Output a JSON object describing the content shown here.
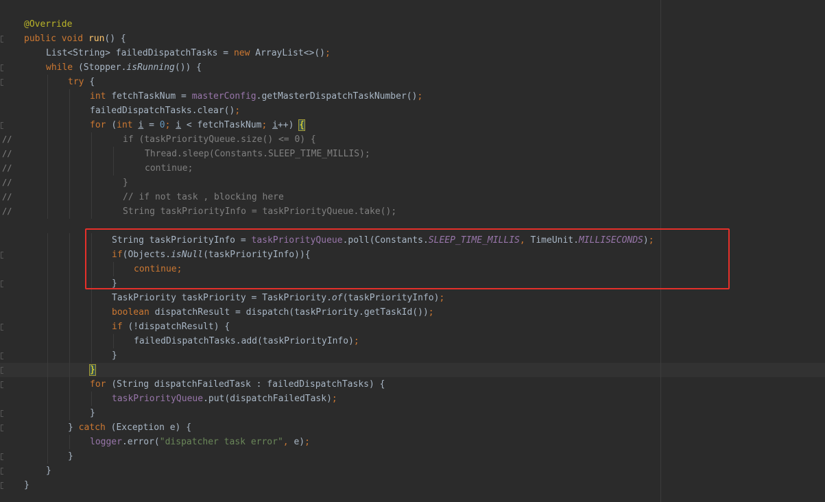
{
  "editor": {
    "language": "java",
    "colors": {
      "background": "#2b2b2b",
      "current_line": "#323232",
      "default_text": "#a9b7c6",
      "keyword": "#cc7832",
      "annotation": "#bbb529",
      "method_declaration": "#ffc66d",
      "field": "#9876aa",
      "number": "#6897bb",
      "string": "#6a8759",
      "comment": "#808080",
      "highlight_box": "#e6302a"
    },
    "annotation_box": {
      "color": "#e6302a",
      "covers_lines": "String taskPriorityInfo = taskPriorityQueue.poll(...) through closing brace"
    },
    "lines": [
      {
        "indent": 0,
        "gutter": "",
        "fold": false,
        "tokens": [
          {
            "t": "@Override",
            "c": "ann"
          }
        ]
      },
      {
        "indent": 0,
        "gutter": "",
        "fold": true,
        "tokens": [
          {
            "t": "public ",
            "c": "kw"
          },
          {
            "t": "void ",
            "c": "kw"
          },
          {
            "t": "run",
            "c": "fn"
          },
          {
            "t": "() {",
            "c": ""
          }
        ]
      },
      {
        "indent": 1,
        "gutter": "",
        "fold": false,
        "tokens": [
          {
            "t": "List<String> failedDispatchTasks = ",
            "c": ""
          },
          {
            "t": "new ",
            "c": "kw"
          },
          {
            "t": "ArrayList<>()",
            "c": ""
          },
          {
            "t": ";",
            "c": "kw"
          }
        ]
      },
      {
        "indent": 1,
        "gutter": "",
        "fold": true,
        "tokens": [
          {
            "t": "while ",
            "c": "kw"
          },
          {
            "t": "(Stopper.",
            "c": ""
          },
          {
            "t": "isRunning",
            "c": "sta"
          },
          {
            "t": "()) {",
            "c": ""
          }
        ]
      },
      {
        "indent": 2,
        "gutter": "",
        "fold": true,
        "tokens": [
          {
            "t": "try ",
            "c": "kw"
          },
          {
            "t": "{",
            "c": ""
          }
        ]
      },
      {
        "indent": 3,
        "gutter": "",
        "fold": false,
        "tokens": [
          {
            "t": "int ",
            "c": "kw"
          },
          {
            "t": "fetchTaskNum = ",
            "c": ""
          },
          {
            "t": "masterConfig",
            "c": "fld"
          },
          {
            "t": ".getMasterDispatchTaskNumber()",
            "c": ""
          },
          {
            "t": ";",
            "c": "kw"
          }
        ]
      },
      {
        "indent": 3,
        "gutter": "",
        "fold": false,
        "tokens": [
          {
            "t": "failedDispatchTasks.clear()",
            "c": ""
          },
          {
            "t": ";",
            "c": "kw"
          }
        ]
      },
      {
        "indent": 3,
        "gutter": "",
        "fold": true,
        "tokens": [
          {
            "t": "for ",
            "c": "kw"
          },
          {
            "t": "(",
            "c": ""
          },
          {
            "t": "int ",
            "c": "kw"
          },
          {
            "t": "i",
            "c": "u"
          },
          {
            "t": " = ",
            "c": ""
          },
          {
            "t": "0",
            "c": "num"
          },
          {
            "t": "; ",
            "c": "kw"
          },
          {
            "t": "i",
            "c": "u"
          },
          {
            "t": " < fetchTaskNum",
            "c": ""
          },
          {
            "t": "; ",
            "c": "kw"
          },
          {
            "t": "i",
            "c": "u"
          },
          {
            "t": "++) ",
            "c": ""
          },
          {
            "t": "{",
            "c": "brace"
          }
        ]
      },
      {
        "indent": 0,
        "gutter": "//",
        "fold": false,
        "cmt_indent": 4.5,
        "tokens": [
          {
            "t": "if (taskPriorityQueue.size() <= 0) {",
            "c": "cmt"
          }
        ]
      },
      {
        "indent": 0,
        "gutter": "//",
        "fold": false,
        "cmt_indent": 5.5,
        "tokens": [
          {
            "t": "Thread.sleep(Constants.SLEEP_TIME_MILLIS);",
            "c": "cmt"
          }
        ]
      },
      {
        "indent": 0,
        "gutter": "//",
        "fold": false,
        "cmt_indent": 5.5,
        "tokens": [
          {
            "t": "continue;",
            "c": "cmt"
          }
        ]
      },
      {
        "indent": 0,
        "gutter": "//",
        "fold": false,
        "cmt_indent": 4.5,
        "tokens": [
          {
            "t": "}",
            "c": "cmt"
          }
        ]
      },
      {
        "indent": 0,
        "gutter": "//",
        "fold": false,
        "cmt_indent": 4.5,
        "tokens": [
          {
            "t": "// if not task , blocking here",
            "c": "cmt"
          }
        ]
      },
      {
        "indent": 0,
        "gutter": "//",
        "fold": false,
        "cmt_indent": 4.5,
        "tokens": [
          {
            "t": "String taskPriorityInfo = taskPriorityQueue.take();",
            "c": "cmt"
          }
        ]
      },
      {
        "indent": 0,
        "gutter": "",
        "fold": false,
        "tokens": []
      },
      {
        "indent": 4,
        "gutter": "",
        "fold": false,
        "tokens": [
          {
            "t": "String taskPriorityInfo = ",
            "c": ""
          },
          {
            "t": "taskPriorityQueue",
            "c": "fld"
          },
          {
            "t": ".poll(Constants.",
            "c": ""
          },
          {
            "t": "SLEEP_TIME_MILLIS",
            "c": "fldi"
          },
          {
            "t": ", ",
            "c": "kw"
          },
          {
            "t": "TimeUnit.",
            "c": ""
          },
          {
            "t": "MILLISECONDS",
            "c": "fldi"
          },
          {
            "t": ")",
            "c": ""
          },
          {
            "t": ";",
            "c": "kw"
          }
        ]
      },
      {
        "indent": 4,
        "gutter": "",
        "fold": true,
        "tokens": [
          {
            "t": "if",
            "c": "kw"
          },
          {
            "t": "(Objects.",
            "c": ""
          },
          {
            "t": "isNull",
            "c": "sta"
          },
          {
            "t": "(taskPriorityInfo)){",
            "c": ""
          }
        ]
      },
      {
        "indent": 5,
        "gutter": "",
        "fold": false,
        "tokens": [
          {
            "t": "continue;",
            "c": "kw"
          }
        ]
      },
      {
        "indent": 4,
        "gutter": "",
        "fold": true,
        "tokens": [
          {
            "t": "}",
            "c": ""
          }
        ]
      },
      {
        "indent": 4,
        "gutter": "",
        "fold": false,
        "tokens": [
          {
            "t": "TaskPriority taskPriority = TaskPriority.",
            "c": ""
          },
          {
            "t": "of",
            "c": "sta"
          },
          {
            "t": "(taskPriorityInfo)",
            "c": ""
          },
          {
            "t": ";",
            "c": "kw"
          }
        ]
      },
      {
        "indent": 4,
        "gutter": "",
        "fold": false,
        "tokens": [
          {
            "t": "boolean ",
            "c": "kw"
          },
          {
            "t": "dispatchResult = dispatch(taskPriority.getTaskId())",
            "c": ""
          },
          {
            "t": ";",
            "c": "kw"
          }
        ]
      },
      {
        "indent": 4,
        "gutter": "",
        "fold": true,
        "tokens": [
          {
            "t": "if ",
            "c": "kw"
          },
          {
            "t": "(!dispatchResult) {",
            "c": ""
          }
        ]
      },
      {
        "indent": 5,
        "gutter": "",
        "fold": false,
        "tokens": [
          {
            "t": "failedDispatchTasks.add(taskPriorityInfo)",
            "c": ""
          },
          {
            "t": ";",
            "c": "kw"
          }
        ]
      },
      {
        "indent": 4,
        "gutter": "",
        "fold": true,
        "tokens": [
          {
            "t": "}",
            "c": ""
          }
        ]
      },
      {
        "indent": 3,
        "gutter": "",
        "fold": true,
        "current": true,
        "tokens": [
          {
            "t": "}",
            "c": "brace"
          }
        ]
      },
      {
        "indent": 3,
        "gutter": "",
        "fold": true,
        "tokens": [
          {
            "t": "for ",
            "c": "kw"
          },
          {
            "t": "(String dispatchFailedTask : failedDispatchTasks) {",
            "c": ""
          }
        ]
      },
      {
        "indent": 4,
        "gutter": "",
        "fold": false,
        "tokens": [
          {
            "t": "taskPriorityQueue",
            "c": "fld"
          },
          {
            "t": ".put(dispatchFailedTask)",
            "c": ""
          },
          {
            "t": ";",
            "c": "kw"
          }
        ]
      },
      {
        "indent": 3,
        "gutter": "",
        "fold": true,
        "tokens": [
          {
            "t": "}",
            "c": ""
          }
        ]
      },
      {
        "indent": 2,
        "gutter": "",
        "fold": true,
        "tokens": [
          {
            "t": "} ",
            "c": ""
          },
          {
            "t": "catch ",
            "c": "kw"
          },
          {
            "t": "(Exception e) {",
            "c": ""
          }
        ]
      },
      {
        "indent": 3,
        "gutter": "",
        "fold": false,
        "tokens": [
          {
            "t": "logger",
            "c": "fld"
          },
          {
            "t": ".error(",
            "c": ""
          },
          {
            "t": "\"dispatcher task error\"",
            "c": "str"
          },
          {
            "t": ", ",
            "c": "kw"
          },
          {
            "t": "e)",
            "c": ""
          },
          {
            "t": ";",
            "c": "kw"
          }
        ]
      },
      {
        "indent": 2,
        "gutter": "",
        "fold": true,
        "tokens": [
          {
            "t": "}",
            "c": ""
          }
        ]
      },
      {
        "indent": 1,
        "gutter": "",
        "fold": true,
        "tokens": [
          {
            "t": "}",
            "c": ""
          }
        ]
      },
      {
        "indent": 0,
        "gutter": "",
        "fold": true,
        "tokens": [
          {
            "t": "}",
            "c": ""
          }
        ]
      }
    ]
  }
}
